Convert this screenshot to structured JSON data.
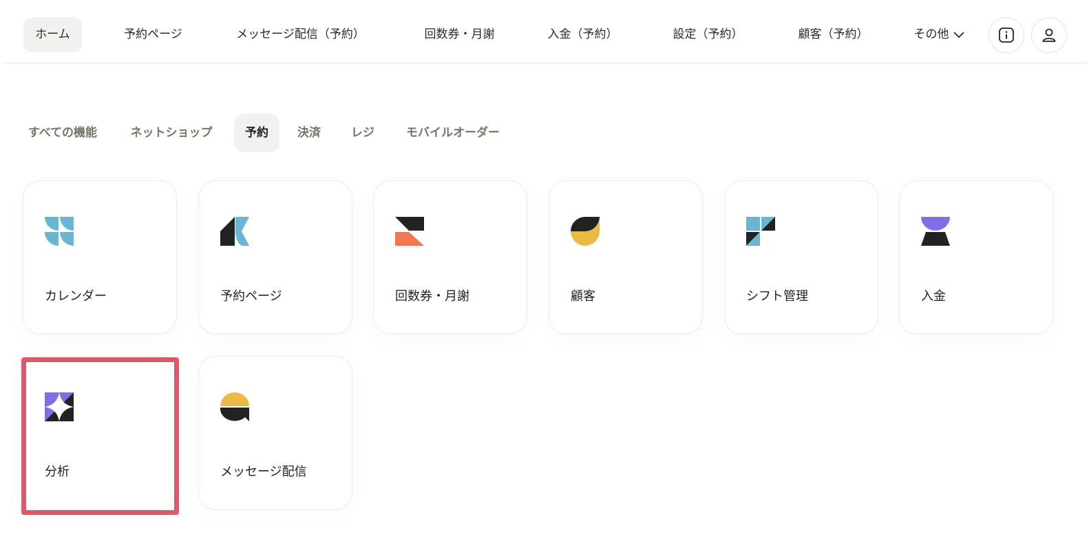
{
  "topnav": {
    "items": [
      {
        "label": "ホーム",
        "active": true
      },
      {
        "label": "予約ページ"
      },
      {
        "label": "メッセージ配信（予約）"
      },
      {
        "label": "回数券・月謝"
      },
      {
        "label": "入金（予約）"
      },
      {
        "label": "設定（予約）"
      },
      {
        "label": "顧客（予約）"
      }
    ],
    "more_label": "その他",
    "more_icon": "chevron-down-icon",
    "info_icon": "info-icon",
    "user_icon": "user-icon"
  },
  "tabs": [
    {
      "label": "すべての機能"
    },
    {
      "label": "ネットショップ"
    },
    {
      "label": "予約",
      "active": true
    },
    {
      "label": "決済"
    },
    {
      "label": "レジ"
    },
    {
      "label": "モバイルオーダー"
    }
  ],
  "cards": [
    {
      "label": "カレンダー",
      "icon": "calendar-icon",
      "color": "#6ab5d1"
    },
    {
      "label": "予約ページ",
      "icon": "reservation-page-icon",
      "color": "#6ab5d1"
    },
    {
      "label": "回数券・月謝",
      "icon": "ticket-icon",
      "color": "#ee7a4c"
    },
    {
      "label": "顧客",
      "icon": "customer-icon",
      "color": "#e8bb44"
    },
    {
      "label": "シフト管理",
      "icon": "shift-icon",
      "color": "#6ab5d1"
    },
    {
      "label": "入金",
      "icon": "payment-icon",
      "color": "#7f6ee6"
    },
    {
      "label": "分析",
      "icon": "analytics-icon",
      "color": "#7f6ee6",
      "selected": true
    },
    {
      "label": "メッセージ配信",
      "icon": "message-icon",
      "color": "#e8bb44"
    }
  ],
  "colors": {
    "highlight": "#e0566b",
    "dark": "#222222",
    "active_bg": "#f1f1f0",
    "tab_text": "#777569"
  }
}
